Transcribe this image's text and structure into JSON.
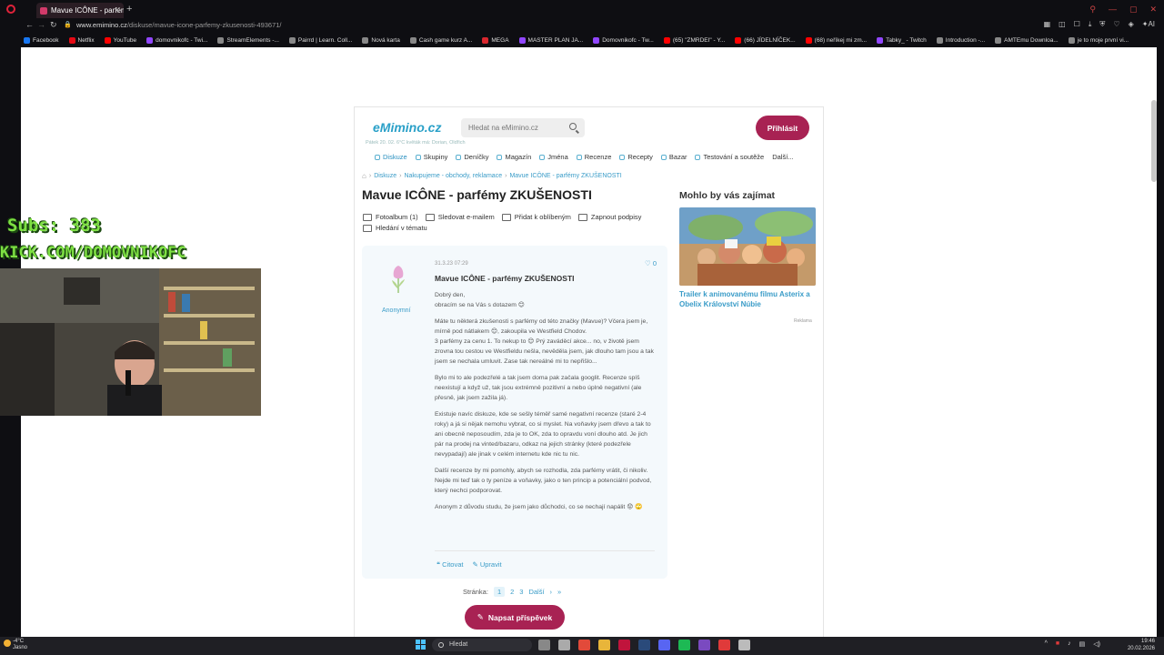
{
  "browser": {
    "tab_title": "Mavue ICÔNE - parfémy Z",
    "url_host": "www.emimino.cz",
    "url_path": "/diskuse/mavue-icone-parfemy-zkusenosti-493671/",
    "bookmarks": [
      {
        "label": "Facebook",
        "color": "#1877f2"
      },
      {
        "label": "Netflix",
        "color": "#e50914"
      },
      {
        "label": "YouTube",
        "color": "#ff0000"
      },
      {
        "label": "domovnikofc - Twi...",
        "color": "#9146ff"
      },
      {
        "label": "StreamElements -...",
        "color": "#888888"
      },
      {
        "label": "Pairrd | Learn. Coll...",
        "color": "#888888"
      },
      {
        "label": "Nová karta",
        "color": "#888888"
      },
      {
        "label": "Cash game kurz A...",
        "color": "#888888"
      },
      {
        "label": "MEGA",
        "color": "#d9272e"
      },
      {
        "label": "MASTER PLAN JA...",
        "color": "#9146ff"
      },
      {
        "label": "Domovnikofc - Tw...",
        "color": "#9146ff"
      },
      {
        "label": "(65) \"ZMRDEI\" - Y...",
        "color": "#ff0000"
      },
      {
        "label": "(66) JÍDELNÍČEK...",
        "color": "#ff0000"
      },
      {
        "label": "(68) neříkej mi zm...",
        "color": "#ff0000"
      },
      {
        "label": "Tabky_ - Twitch",
        "color": "#9146ff"
      },
      {
        "label": "Introduction -...",
        "color": "#888888"
      },
      {
        "label": "AMTEmu Downloa...",
        "color": "#888888"
      },
      {
        "label": "je to moje první vi...",
        "color": "#888888"
      }
    ]
  },
  "site": {
    "logo": "eMimino.cz",
    "logo_sub": "Pátek 20. 02.   6°C květák má: Dorian, Oldřich",
    "search_placeholder": "Hledat na eMimino.cz",
    "login_label": "Přihlásit",
    "menu": [
      "Diskuze",
      "Skupiny",
      "Deníčky",
      "Magazín",
      "Jména",
      "Recenze",
      "Recepty",
      "Bazar",
      "Testování a soutěže",
      "Další..."
    ],
    "breadcrumbs": [
      "Diskuze",
      "Nakupujeme - obchody, reklamace",
      "Mavue ICÔNE - parfémy ZKUŠENOSTI"
    ],
    "title": "Mavue ICÔNE - parfémy ZKUŠENOSTI",
    "actions": [
      "Fotoalbum (1)",
      "Sledovat e-mailem",
      "Přidat k oblíbeným",
      "Zapnout podpisy",
      "Hledání v tématu"
    ],
    "post": {
      "author": "Anonymní",
      "date": "31.3.23 07:29",
      "likes": "0",
      "title": "Mavue ICÔNE - parfémy ZKUŠENOSTI",
      "paragraphs": [
        "Dobrý den,\nobracím se na Vás s dotazem 😊",
        "Máte tu některá zkušenosti s parfémy od této značky (Mavue)? Včera jsem je, mírně pod nátlakem 😊, zakoupila ve Westfield Chodov.\n3 parfémy za cenu 1. To nekup to 😊 Prý zaváděcí akce... no, v životě jsem zrovna tou cestou ve Westfieldu nešla, nevěděla jsem, jak dlouho tam jsou a tak jsem se nechala umluvit. Zase tak nereálné mi to nepřišlo...",
        "Bylo mi to ale podezřelé a tak jsem doma pak začala googlit. Recenze spíš neexistují a když už, tak jsou extrémně pozitivní a nebo úplně negativní (ale přesně, jak jsem zažila já).",
        "Existuje navíc diskuze, kde se sešly téměř samé negativní recenze (staré 2-4 roky) a já si nějak nemohu vybrat, co si myslet. Na voňavky jsem dřevo a tak to ani obecně neposoudím, zda je to OK, zda to opravdu voní dlouho atd. Je jich pár na prodej na vinted/bazaru, odkaz na jejich stránky (které podezřele nevypadají) ale jinak v celém internetu kde nic tu nic.",
        "Další recenze by mi pomohly, abych se rozhodla, zda parfémy vrátit, či nikoliv. Nejde mi teď tak o ty peníze a voňavky, jako o ten princip a potenciální podvod, který nechci podporovat.",
        "Anonym z důvodu studu, že jsem jako důchodci, co se nechají napálit 😟 🙄"
      ],
      "quote_label": "Citovat",
      "edit_label": "Upravit"
    },
    "pager": {
      "label": "Stránka:",
      "pages": [
        "1",
        "2",
        "3"
      ],
      "next": "Další",
      "arrow": "›",
      "last": "»"
    },
    "write_label": "Napsat příspěvek",
    "sidebar": {
      "heading": "Mohlo by vás zajímat",
      "caption": "Trailer k animovanému filmu Asterix a Obelix Království Núbie",
      "ad_label": "Reklama"
    }
  },
  "overlay": {
    "subs": "Subs: 383",
    "kick": "KICK.COM/DOMOVNIKOFC"
  },
  "taskbar": {
    "weather_temp": "-4°C",
    "weather_text": "Jasno",
    "search": "Hledat",
    "time": "19:46",
    "date": "20.02.2026"
  }
}
